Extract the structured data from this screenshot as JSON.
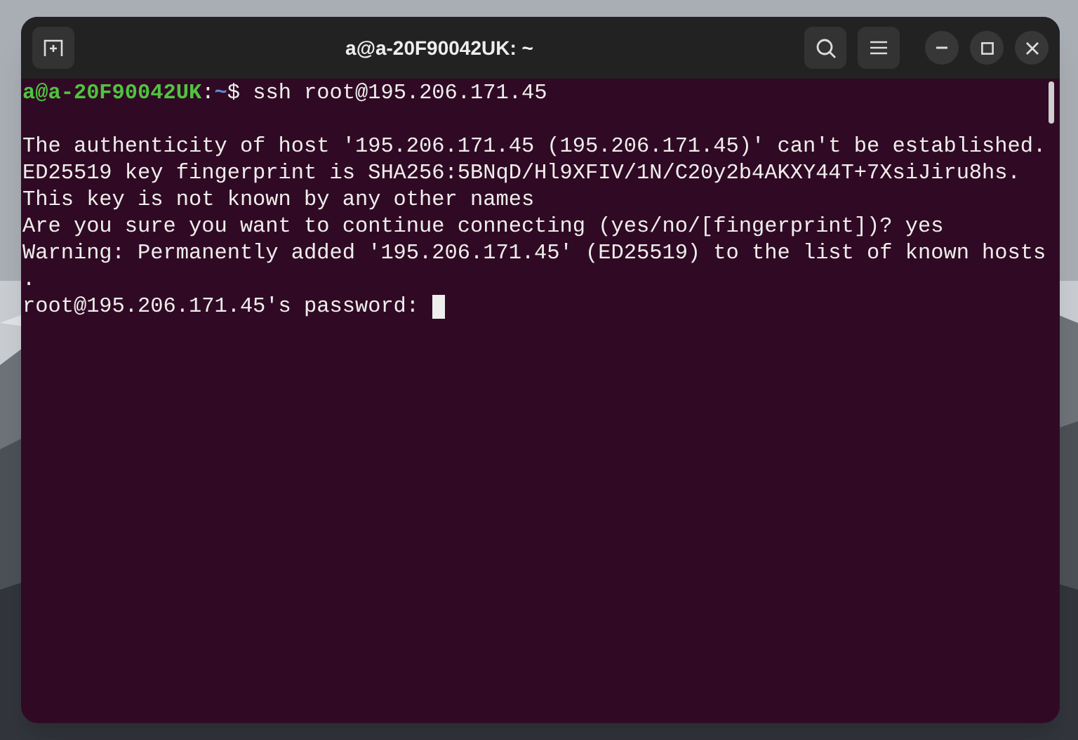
{
  "window": {
    "title": "a@a-20F90042UK: ~"
  },
  "terminal": {
    "prompt": {
      "user_host": "a@a-20F90042UK",
      "separator": ":",
      "path": "~",
      "command": "$ ssh root@195.206.171.45"
    },
    "output": [
      "The authenticity of host '195.206.171.45 (195.206.171.45)' can't be established.",
      "ED25519 key fingerprint is SHA256:5BNqD/Hl9XFIV/1N/C20y2b4AKXY44T+7XsiJiru8hs.",
      "This key is not known by any other names",
      "Are you sure you want to continue connecting (yes/no/[fingerprint])? yes",
      "Warning: Permanently added '195.206.171.45' (ED25519) to the list of known hosts",
      "."
    ],
    "password_prompt": "root@195.206.171.45's password: ",
    "cursor_visible": true
  }
}
